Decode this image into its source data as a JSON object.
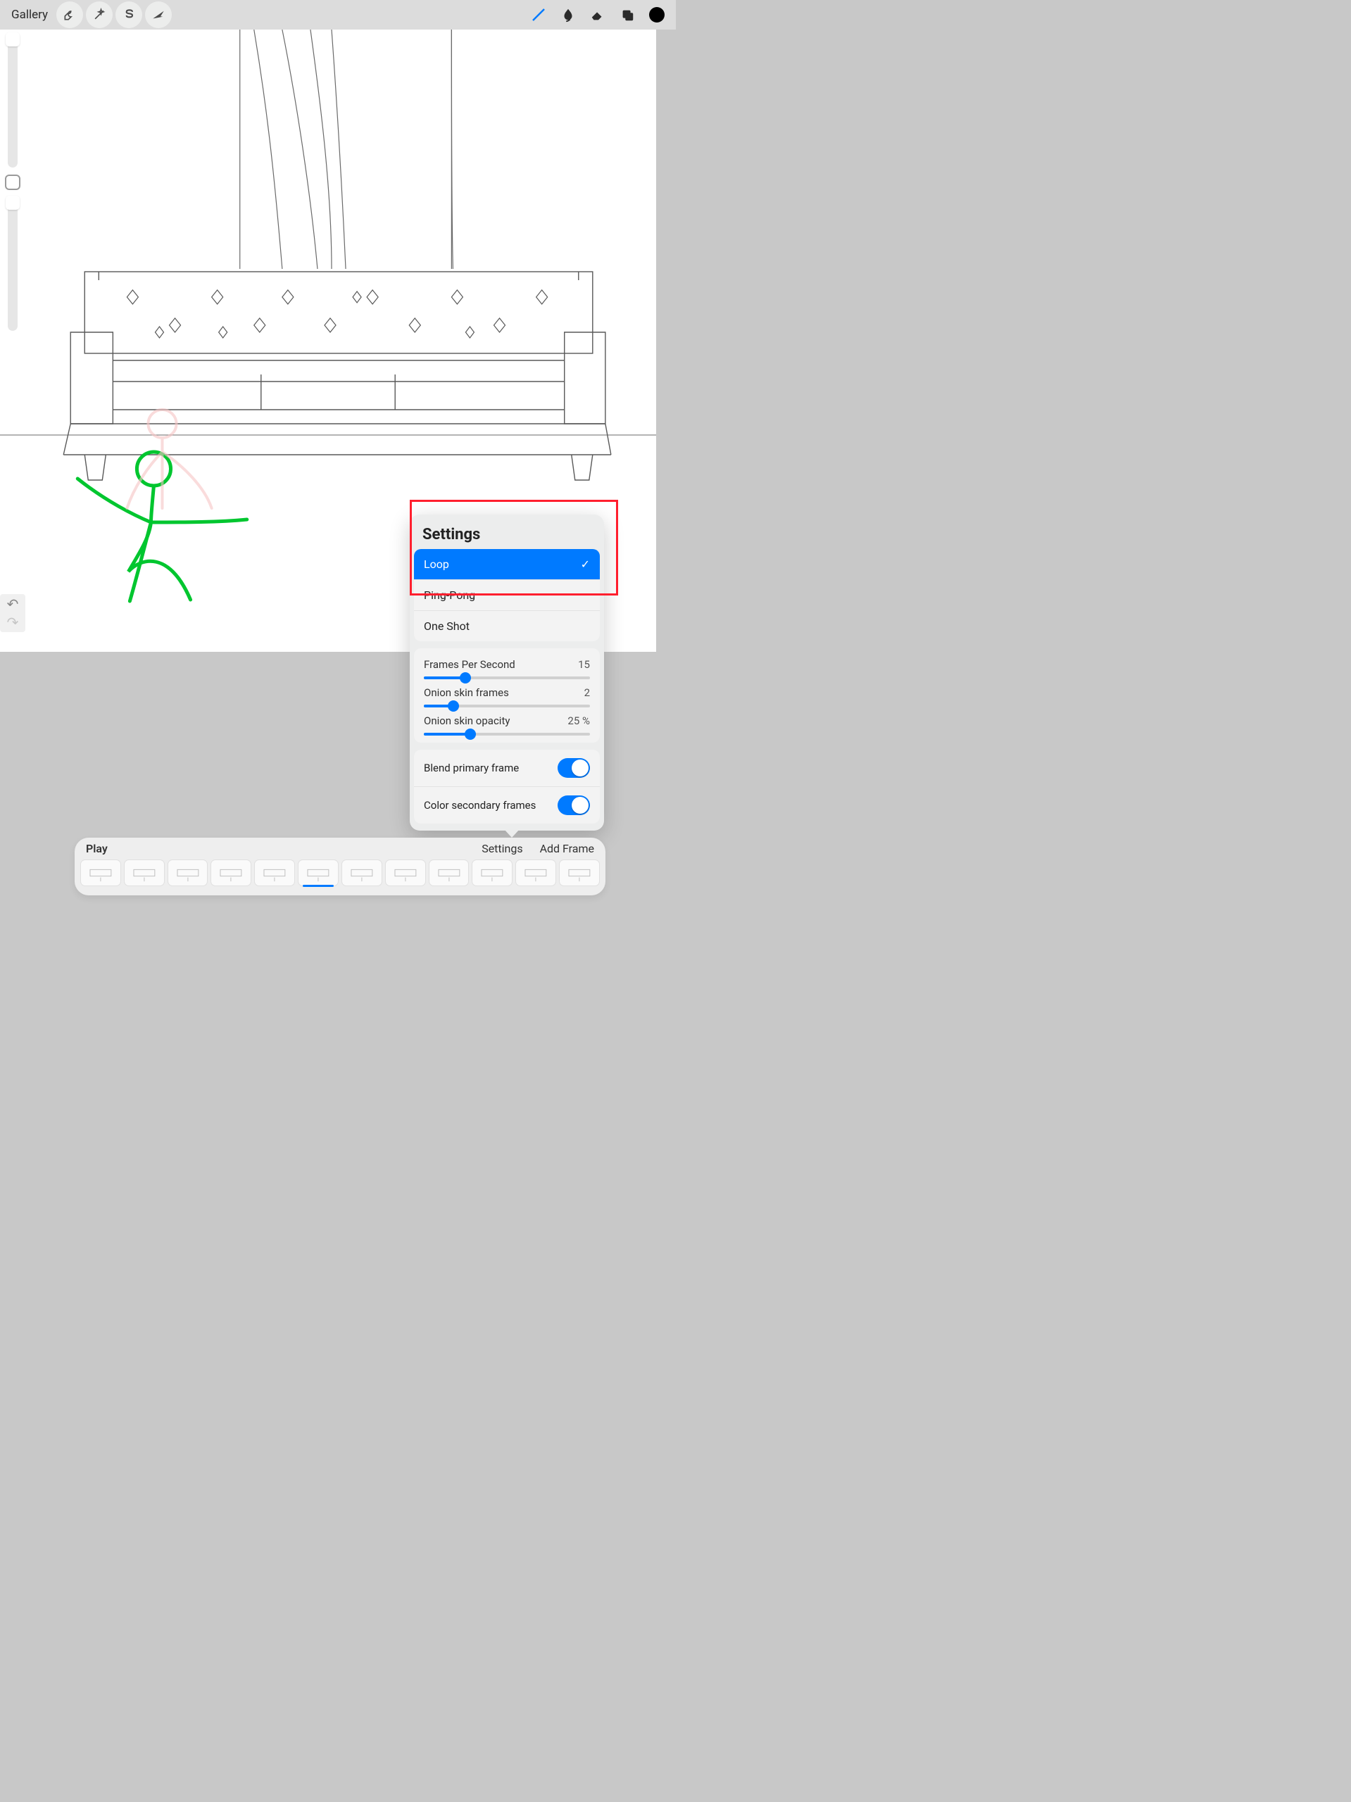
{
  "topbar": {
    "gallery": "Gallery",
    "icons": {
      "wrench": "wrench-icon",
      "wand": "wand-icon",
      "select": "select-s-icon",
      "move": "arrow-cursor-icon",
      "brush": "brush-icon",
      "smudge": "smudge-icon",
      "eraser": "eraser-icon",
      "layers": "layers-icon",
      "color": "color-swatch"
    },
    "color_hex": "#000000",
    "brush_active_color": "#007AFF"
  },
  "timeline": {
    "play": "Play",
    "settings": "Settings",
    "add_frame": "Add Frame",
    "frame_count": 12,
    "active_index": 5
  },
  "settings_popover": {
    "title": "Settings",
    "modes": [
      "Loop",
      "Ping-Pong",
      "One Shot"
    ],
    "selected_mode_index": 0,
    "fps_label": "Frames Per Second",
    "fps_value": "15",
    "fps_pct": 25,
    "onion_frames_label": "Onion skin frames",
    "onion_frames_value": "2",
    "onion_frames_pct": 18,
    "onion_opacity_label": "Onion skin opacity",
    "onion_opacity_value": "25 %",
    "onion_opacity_pct": 28,
    "blend_primary_label": "Blend primary frame",
    "blend_primary_on": true,
    "color_secondary_label": "Color secondary frames",
    "color_secondary_on": true
  },
  "annotation": {
    "highlight_box": "modes-list-red-rectangle"
  }
}
